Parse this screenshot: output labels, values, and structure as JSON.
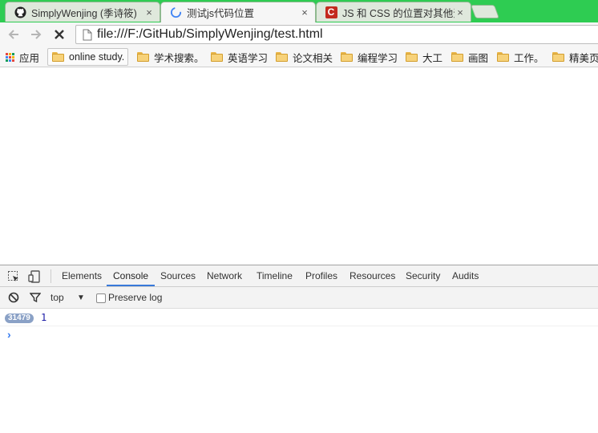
{
  "browser": {
    "tabs": [
      {
        "title": "SimplyWenjing (季诗筱)",
        "favicon": "github-icon",
        "active": false,
        "close": "×"
      },
      {
        "title": "测试js代码位置",
        "favicon": "loading-spinner-icon",
        "active": true,
        "close": "×"
      },
      {
        "title": "JS 和 CSS 的位置对其他资",
        "favicon": "csdn-icon",
        "favicon_text": "C",
        "active": false,
        "close": "×"
      }
    ],
    "url": "file:///F:/GitHub/SimplyWenjing/test.html",
    "bookmarks": [
      {
        "label": "应用",
        "icon": "apps-grid-icon"
      },
      {
        "label": "online study.",
        "icon": "folder-icon"
      },
      {
        "label": "学术搜索。",
        "icon": "folder-icon"
      },
      {
        "label": "英语学习",
        "icon": "folder-icon"
      },
      {
        "label": "论文相关",
        "icon": "folder-icon"
      },
      {
        "label": "编程学习",
        "icon": "folder-icon"
      },
      {
        "label": "大工",
        "icon": "folder-icon"
      },
      {
        "label": "画图",
        "icon": "folder-icon"
      },
      {
        "label": "工作。",
        "icon": "folder-icon"
      },
      {
        "label": "精美页",
        "icon": "folder-icon"
      }
    ]
  },
  "devtools": {
    "tabs": [
      "Elements",
      "Console",
      "Sources",
      "Network",
      "Timeline",
      "Profiles",
      "Resources",
      "Security",
      "Audits"
    ],
    "active_tab": "Console",
    "console": {
      "context": "top",
      "context_arrow": "▼",
      "preserve_log_label": "Preserve log",
      "preserve_log_checked": false,
      "log": {
        "badge": "31479",
        "message": "1"
      },
      "prompt": "›"
    }
  },
  "colors": {
    "tabstrip": "#2ecc52",
    "accent": "#3879d9",
    "badge": "#8aa1c6"
  }
}
